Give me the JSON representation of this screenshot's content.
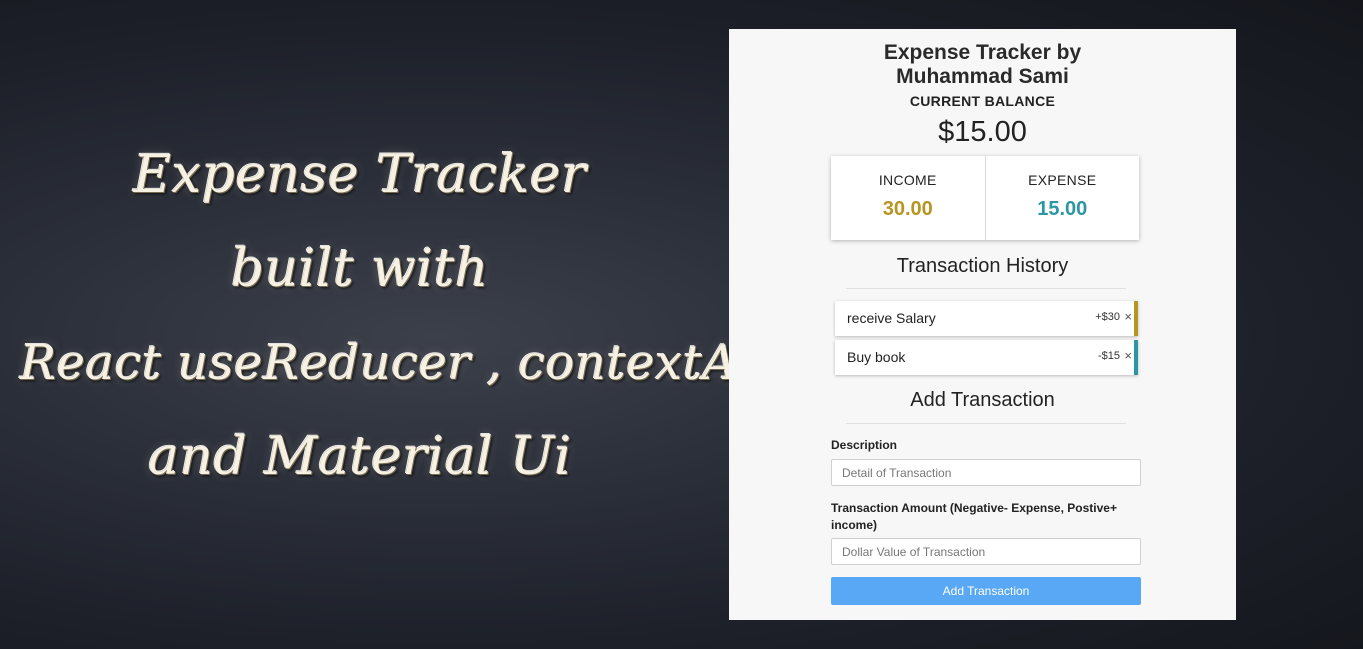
{
  "banner": {
    "lines": [
      "Expense Tracker",
      "built with",
      "React useReducer , contextApi",
      "and Material Ui"
    ]
  },
  "app": {
    "title_line1": "Expense Tracker by",
    "title_line2": "Muhammad Sami",
    "balance_label": "CURRENT BALANCE",
    "balance_value": "$15.00",
    "income_label": "INCOME",
    "income_value": "30.00",
    "expense_label": "EXPENSE",
    "expense_value": "15.00",
    "history_title": "Transaction History",
    "transactions": [
      {
        "description": "receive Salary",
        "amount": "+$30",
        "delete": "×"
      },
      {
        "description": "Buy book",
        "amount": "-$15",
        "delete": "×"
      }
    ],
    "add_title": "Add Transaction",
    "description_label": "Description",
    "description_placeholder": "Detail of Transaction",
    "amount_label": "Transaction Amount (Negative- Expense, Postive+ income)",
    "amount_placeholder": "Dollar Value of Transaction",
    "submit_label": "Add Transaction"
  },
  "colors": {
    "income": "#b89520",
    "expense": "#2c97a3",
    "button": "#58a8f6"
  }
}
